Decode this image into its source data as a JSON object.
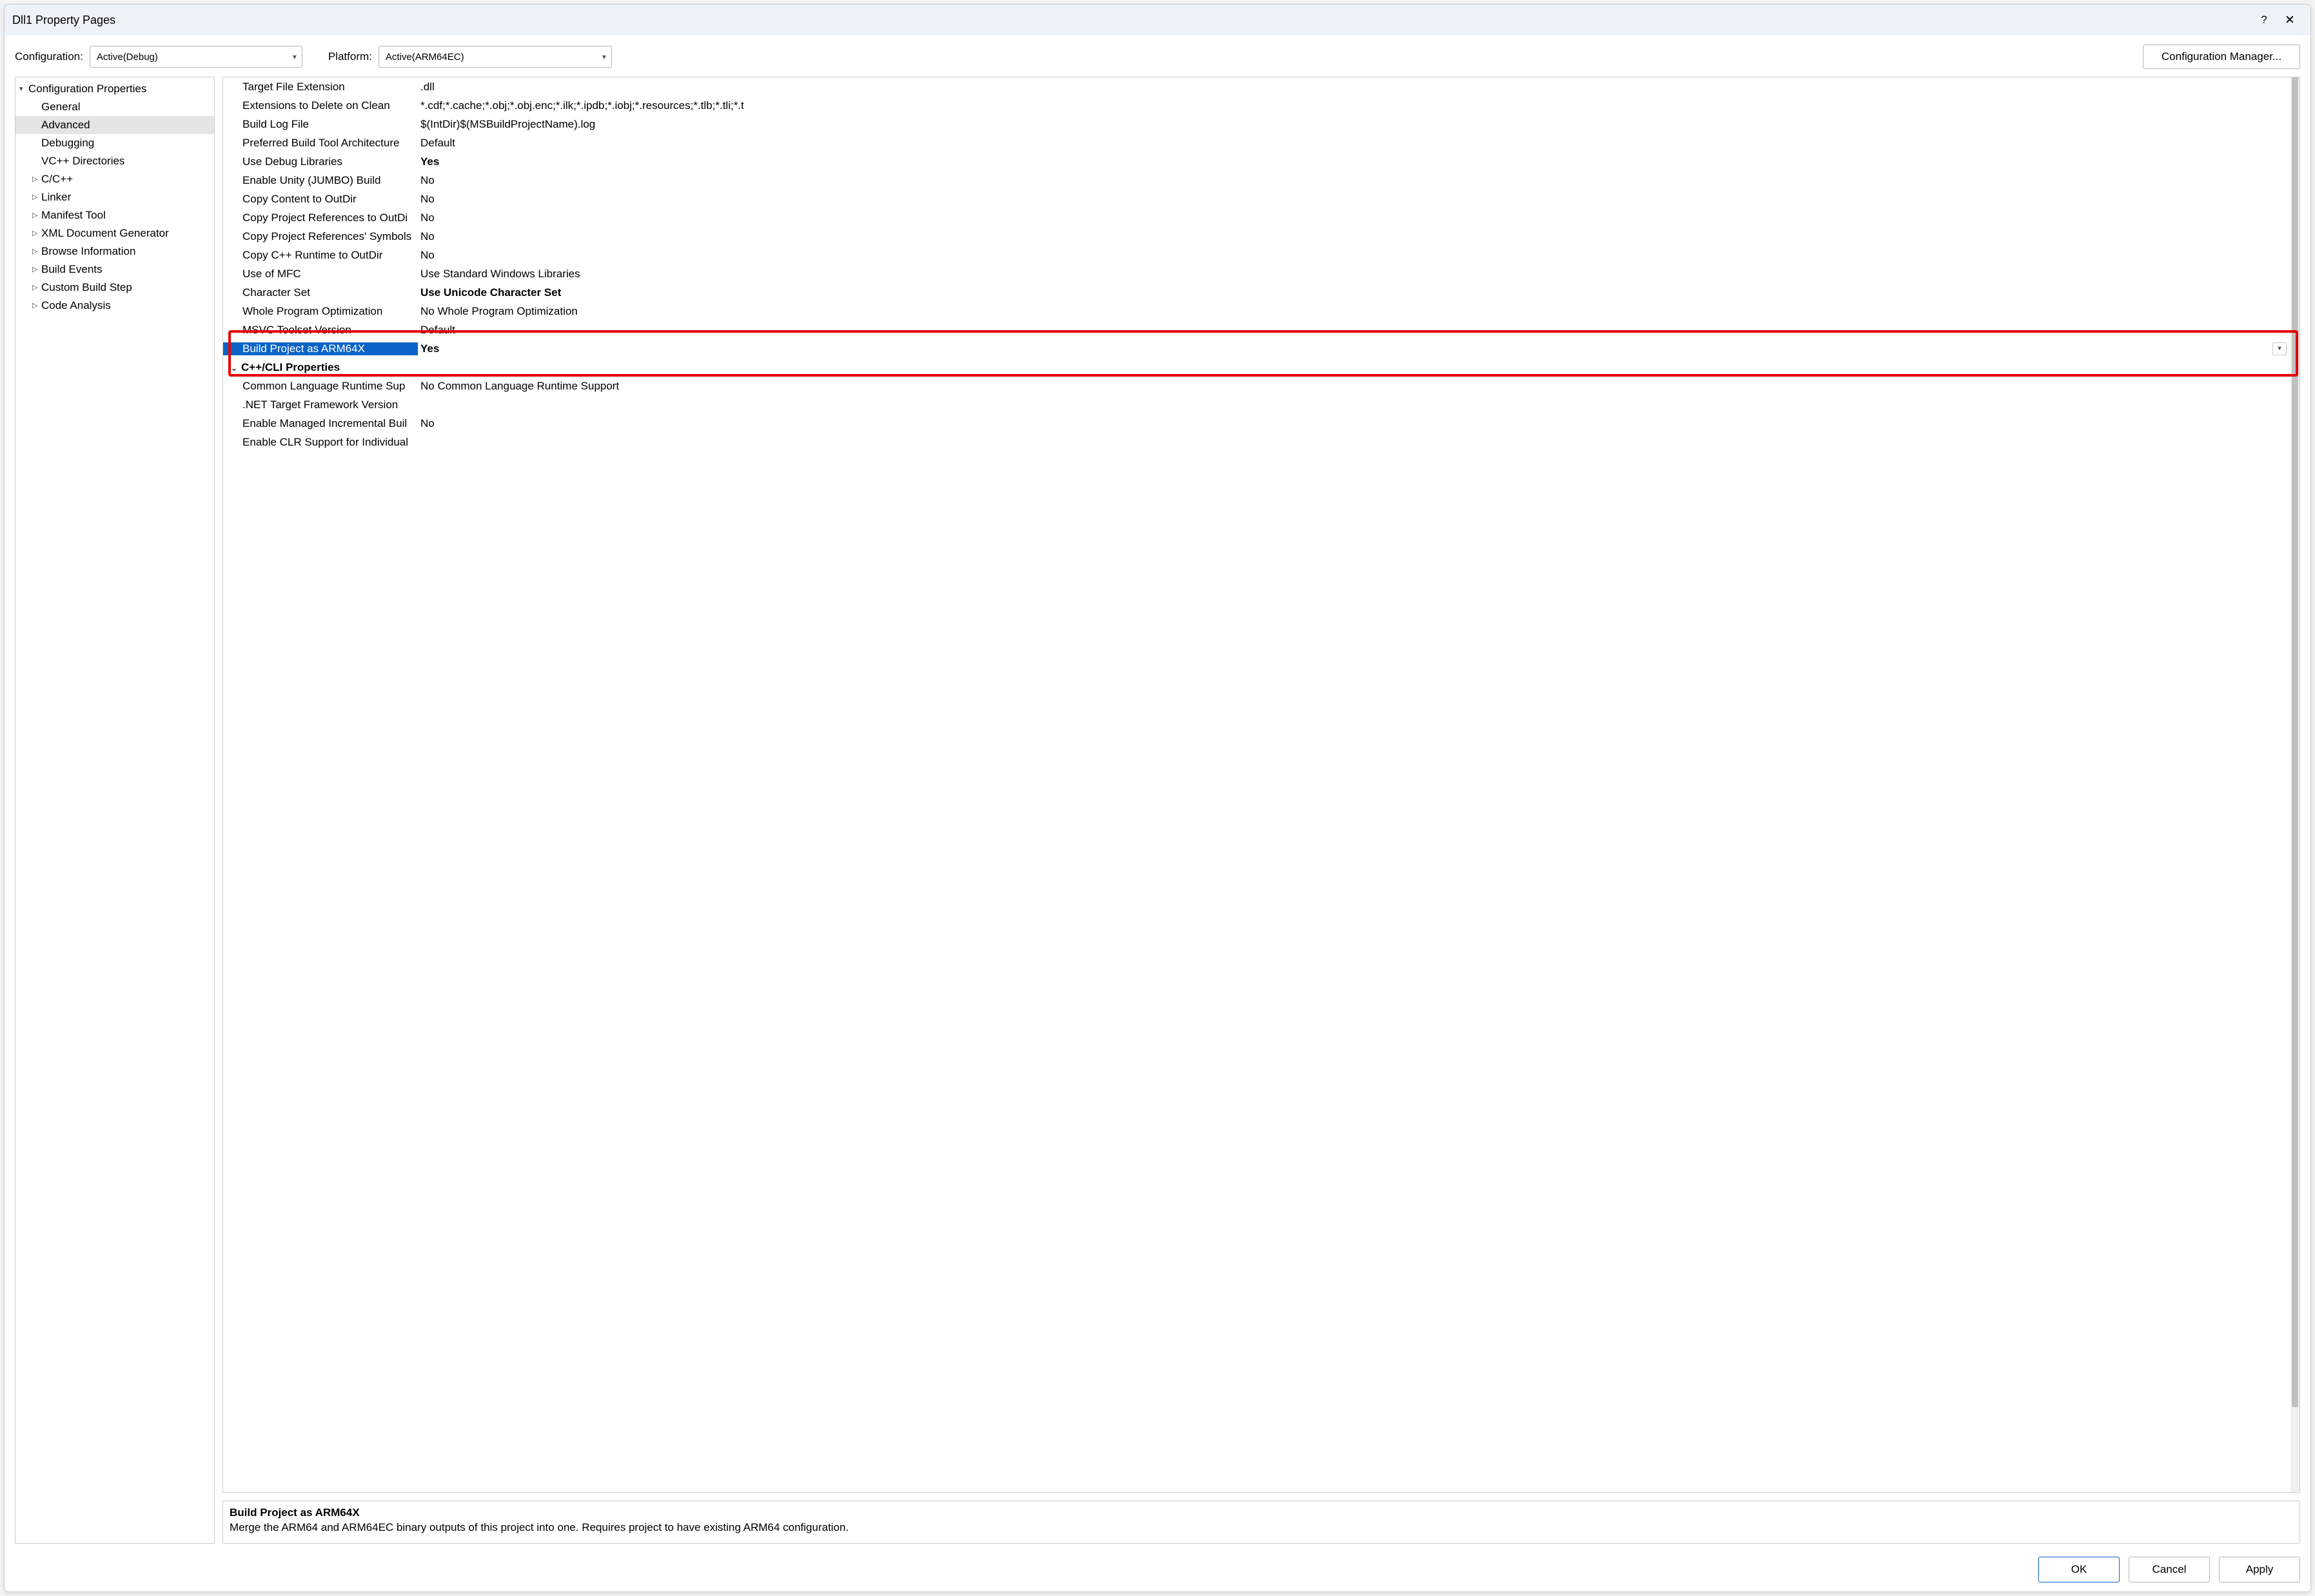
{
  "window": {
    "title": "Dll1 Property Pages"
  },
  "top": {
    "config_label": "Configuration:",
    "config_value": "Active(Debug)",
    "platform_label": "Platform:",
    "platform_value": "Active(ARM64EC)",
    "cfg_mgr": "Configuration Manager..."
  },
  "tree": {
    "root": "Configuration Properties",
    "items": [
      {
        "label": "General",
        "expandable": false
      },
      {
        "label": "Advanced",
        "expandable": false,
        "selected": true
      },
      {
        "label": "Debugging",
        "expandable": false
      },
      {
        "label": "VC++ Directories",
        "expandable": false
      },
      {
        "label": "C/C++",
        "expandable": true
      },
      {
        "label": "Linker",
        "expandable": true
      },
      {
        "label": "Manifest Tool",
        "expandable": true
      },
      {
        "label": "XML Document Generator",
        "expandable": true
      },
      {
        "label": "Browse Information",
        "expandable": true
      },
      {
        "label": "Build Events",
        "expandable": true
      },
      {
        "label": "Custom Build Step",
        "expandable": true
      },
      {
        "label": "Code Analysis",
        "expandable": true
      }
    ]
  },
  "props": [
    {
      "label": "Target File Extension",
      "value": ".dll"
    },
    {
      "label": "Extensions to Delete on Clean",
      "value": "*.cdf;*.cache;*.obj;*.obj.enc;*.ilk;*.ipdb;*.iobj;*.resources;*.tlb;*.tli;*.t"
    },
    {
      "label": "Build Log File",
      "value": "$(IntDir)$(MSBuildProjectName).log"
    },
    {
      "label": "Preferred Build Tool Architecture",
      "value": "Default"
    },
    {
      "label": "Use Debug Libraries",
      "value": "Yes",
      "bold": true
    },
    {
      "label": "Enable Unity (JUMBO) Build",
      "value": "No"
    },
    {
      "label": "Copy Content to OutDir",
      "value": "No"
    },
    {
      "label": "Copy Project References to OutDi",
      "value": "No"
    },
    {
      "label": "Copy Project References' Symbols",
      "value": "No"
    },
    {
      "label": "Copy C++ Runtime to OutDir",
      "value": "No"
    },
    {
      "label": "Use of MFC",
      "value": "Use Standard Windows Libraries"
    },
    {
      "label": "Character Set",
      "value": "Use Unicode Character Set",
      "bold": true
    },
    {
      "label": "Whole Program Optimization",
      "value": "No Whole Program Optimization"
    },
    {
      "label": "MSVC Toolset Version",
      "value": "Default"
    },
    {
      "label": "Build Project as ARM64X",
      "value": "Yes",
      "bold": true,
      "selected": true
    },
    {
      "section": "C++/CLI Properties"
    },
    {
      "label": "Common Language Runtime Sup",
      "value": "No Common Language Runtime Support"
    },
    {
      "label": ".NET Target Framework Version",
      "value": ""
    },
    {
      "label": "Enable Managed Incremental Buil",
      "value": "No"
    },
    {
      "label": "Enable CLR Support for Individual",
      "value": ""
    }
  ],
  "desc": {
    "title": "Build Project as ARM64X",
    "body": "Merge the ARM64 and ARM64EC binary outputs of this project into one. Requires project to have existing ARM64 configuration."
  },
  "buttons": {
    "ok": "OK",
    "cancel": "Cancel",
    "apply": "Apply"
  }
}
